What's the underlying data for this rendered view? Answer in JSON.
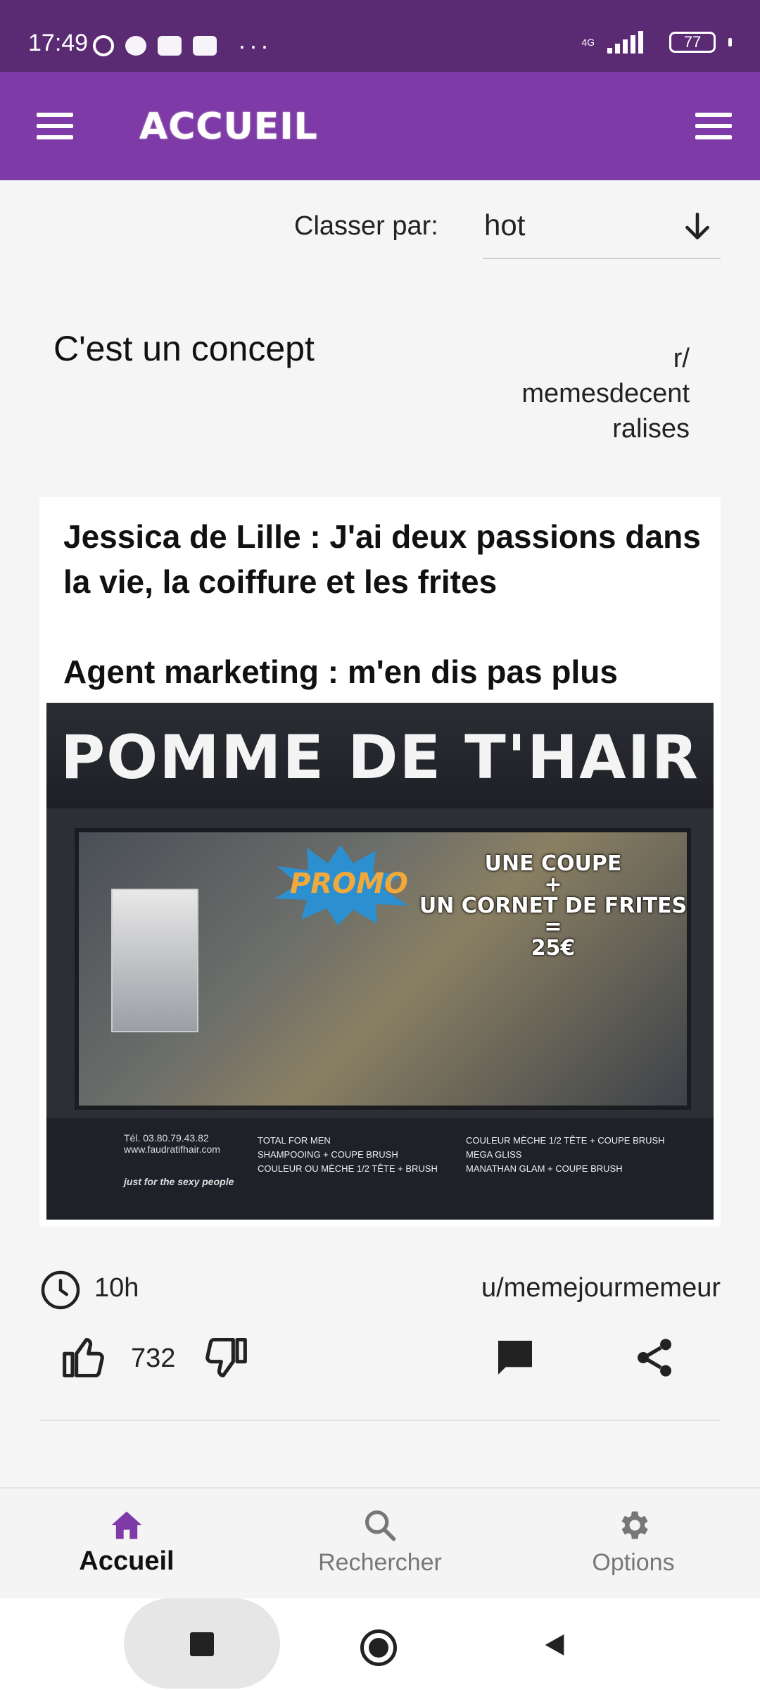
{
  "status_bar": {
    "time": "17:49",
    "network": "4G",
    "battery": "77"
  },
  "app_bar": {
    "title": "ACCUEIL"
  },
  "sort": {
    "label": "Classer par:",
    "value": "hot"
  },
  "post": {
    "title": "C'est un concept",
    "subreddit": "r/\nmemesdecent\nralises",
    "body_line1": "Jessica de Lille : J'ai deux passions dans la vie, la coiffure et les frites",
    "body_line2": "Agent marketing : m'en dis pas plus",
    "image": {
      "banner": "POMME DE T'HAIR",
      "promo": "PROMO",
      "offer": "UNE COUPE\n+\nUN CORNET DE FRITES\n=\n25€",
      "phone": "Tél. 03.80.79.43.82",
      "website": "www.faudratifhair.com",
      "slogan": "just for the sexy people",
      "services_left": "TOTAL FOR MEN\nSHAMPOOING + COUPE BRUSH\nCOULEUR OU MÈCHE 1/2 TÊTE + BRUSH",
      "services_right": "COULEUR MÈCHE 1/2 TÊTE + COUPE BRUSH\nMEGA GLISS\nMANATHAN GLAM + COUPE BRUSH"
    },
    "time_ago": "10h",
    "author": "u/memejourmemeur",
    "score": "732"
  },
  "bottom_nav": {
    "home_label": "Accueil",
    "search_label": "Rechercher",
    "options_label": "Options"
  },
  "colors": {
    "status_bar": "#5a2b73",
    "app_bar": "#7e3aa7",
    "accent": "#7e3aa7"
  }
}
